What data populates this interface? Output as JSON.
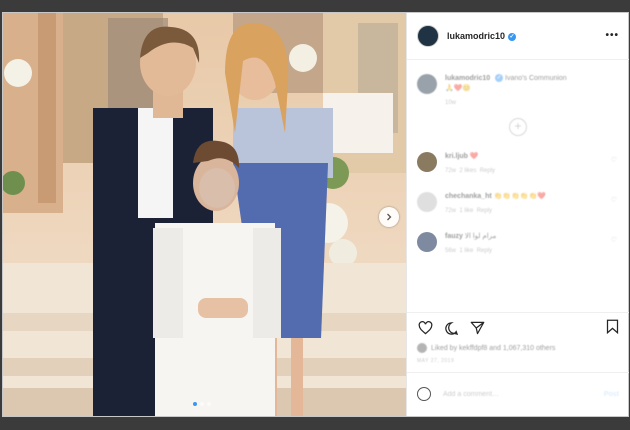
{
  "post": {
    "username": "lukamodric10",
    "more_label": "•••"
  },
  "caption": {
    "username": "lukamodric10",
    "text": "Ivano's Communion",
    "emojis": "🙏❤️😊",
    "time": "10w"
  },
  "comments": [
    {
      "username": "kri.ljub",
      "text": "❤️",
      "time": "72w",
      "likes": "2 likes",
      "reply": "Reply",
      "avatar_color": "#8a7a60"
    },
    {
      "username": "chechanka_ht",
      "text": "👏👏👏👏👏❤️",
      "time": "72w",
      "likes": "1 like",
      "reply": "Reply",
      "avatar_color": "#b9b9b9"
    },
    {
      "username": "fauzy",
      "text": "مرام لوا الا",
      "time": "56w",
      "likes": "1 like",
      "reply": "Reply",
      "avatar_color": "#7d8aa0"
    }
  ],
  "likes": {
    "text": "Liked by kekffdpf8 and 1,067,310 others"
  },
  "date": "MAY 27, 2019",
  "add_comment": {
    "placeholder": "Add a comment…",
    "post_label": "Post"
  },
  "icons": {
    "heart": "heart-icon",
    "comment": "comment-icon",
    "share": "share-icon",
    "save": "bookmark-icon",
    "emoji": "emoji-icon",
    "next": "chevron-right-icon"
  },
  "colors": {
    "accent": "#3897f0",
    "post_disabled": "#b3dbff",
    "like_red": "#ed4956"
  }
}
